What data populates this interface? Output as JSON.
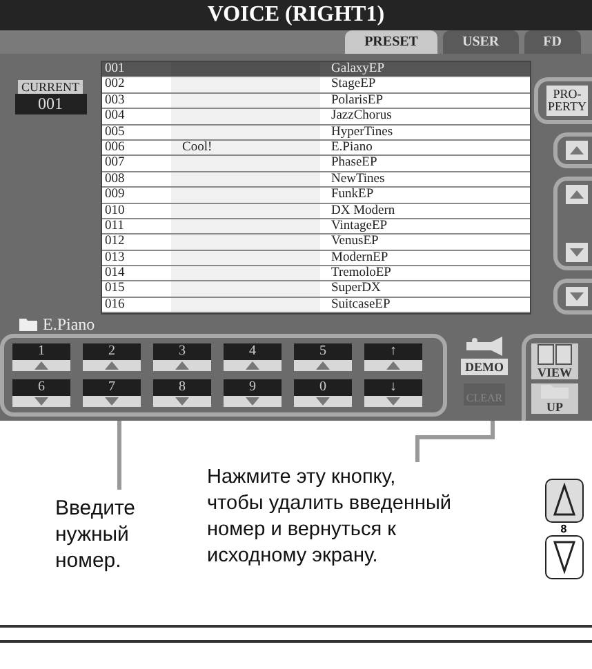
{
  "screen": {
    "title": "VOICE (RIGHT1)",
    "tabs": [
      {
        "label": "PRESET",
        "selected": true
      },
      {
        "label": "USER",
        "selected": false
      },
      {
        "label": "FD",
        "selected": false
      }
    ],
    "current": {
      "label": "CURRENT",
      "value": "001"
    },
    "voices": [
      {
        "number": "001",
        "name": "GalaxyEP",
        "selected": true
      },
      {
        "number": "002",
        "name": "StageEP",
        "selected": false
      },
      {
        "number": "003",
        "name": "PolarisEP",
        "selected": false
      },
      {
        "number": "004",
        "name": "JazzChorus",
        "selected": false
      },
      {
        "number": "005",
        "name": "HyperTines",
        "selected": false
      },
      {
        "number": "006",
        "note": "Cool!",
        "name": "E.Piano",
        "selected": false
      },
      {
        "number": "007",
        "name": "PhaseEP",
        "selected": false
      },
      {
        "number": "008",
        "name": "NewTines",
        "selected": false
      },
      {
        "number": "009",
        "name": "FunkEP",
        "selected": false
      },
      {
        "number": "010",
        "name": "DX Modern",
        "selected": false
      },
      {
        "number": "011",
        "name": "VintageEP",
        "selected": false
      },
      {
        "number": "012",
        "name": "VenusEP",
        "selected": false
      },
      {
        "number": "013",
        "name": "ModernEP",
        "selected": false
      },
      {
        "number": "014",
        "name": "TremoloEP",
        "selected": false
      },
      {
        "number": "015",
        "name": "SuperDX",
        "selected": false
      },
      {
        "number": "016",
        "name": "SuitcaseEP",
        "selected": false
      }
    ],
    "property_button": [
      "PRO-",
      "PERTY"
    ],
    "folder": "E.Piano",
    "keypad": [
      {
        "label": "1",
        "kind": "up"
      },
      {
        "label": "2",
        "kind": "up"
      },
      {
        "label": "3",
        "kind": "up"
      },
      {
        "label": "4",
        "kind": "up"
      },
      {
        "label": "5",
        "kind": "up"
      },
      {
        "label": "↑",
        "kind": "up"
      },
      {
        "label": "6",
        "kind": "down"
      },
      {
        "label": "7",
        "kind": "down"
      },
      {
        "label": "8",
        "kind": "down"
      },
      {
        "label": "9",
        "kind": "down"
      },
      {
        "label": "0",
        "kind": "down"
      },
      {
        "label": "↓",
        "kind": "down"
      }
    ],
    "demo_button": "DEMO",
    "clear_button": {
      "label": "CLEAR",
      "disabled": true
    },
    "view_button": "VIEW",
    "up_button": "UP"
  },
  "callouts": [
    "Введите нужный номер.",
    "Нажмите эту кнопку, чтобы удалить введенный номер и вернуться к исходному экрану."
  ],
  "panel": {
    "label": "8"
  }
}
